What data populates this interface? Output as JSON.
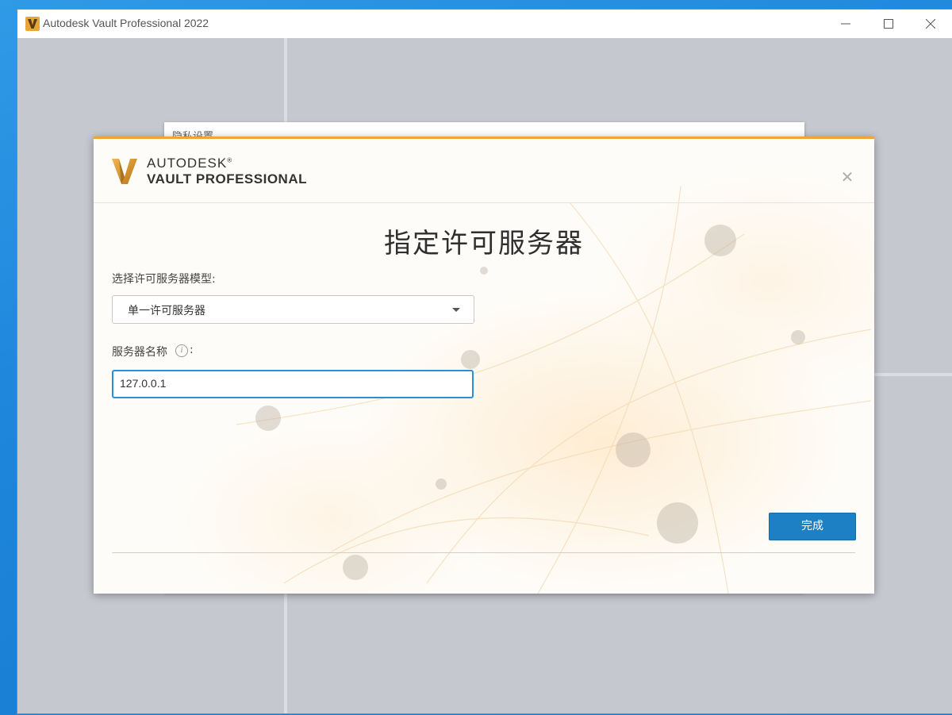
{
  "window": {
    "title": "Autodesk Vault Professional 2022",
    "icons": {
      "app": "vault-v-logo-icon",
      "minimize": "minimize-icon",
      "maximize": "maximize-icon",
      "close": "close-icon"
    }
  },
  "background_panel": {
    "title": "隐私设置"
  },
  "dialog": {
    "brand": {
      "line1": "AUTODESK",
      "mark": "®",
      "line2": "VAULT PROFESSIONAL"
    },
    "title": "指定许可服务器",
    "model_label": "选择许可服务器模型:",
    "model_select": {
      "value": "单一许可服务器"
    },
    "server_label": "服务器名称",
    "server_label_suffix": ":",
    "server_input": {
      "value": "127.0.0.1"
    },
    "info_icon_glyph": "i",
    "finish_button": "完成",
    "close_glyph": "✕",
    "colors": {
      "accent": "#f0a33c",
      "primary_button": "#1d7fc4",
      "input_focus": "#2a8fd6"
    }
  }
}
